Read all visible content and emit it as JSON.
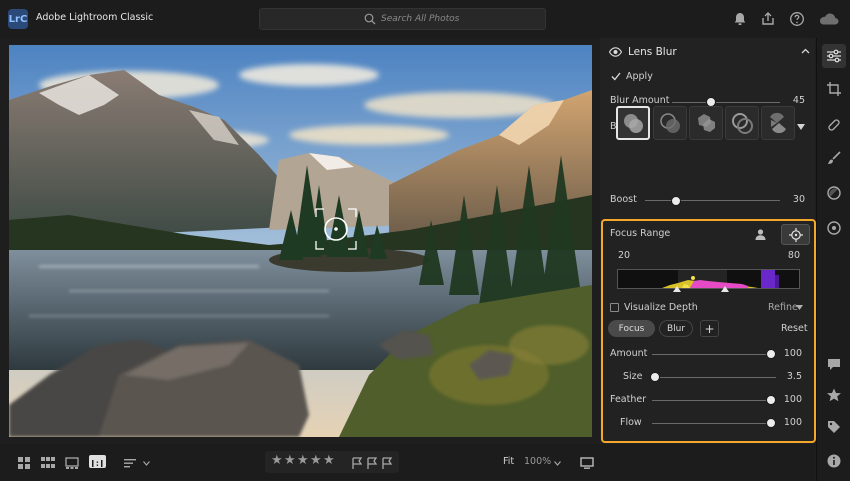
{
  "app": {
    "logo": "LrC",
    "title": "Adobe Lightroom Classic"
  },
  "search": {
    "placeholder": "Search All Photos"
  },
  "panel": {
    "title": "Lens Blur",
    "apply_label": "Apply",
    "apply_checked": true,
    "blur_amount": {
      "label": "Blur Amount",
      "value": 45,
      "max": 100
    },
    "bokeh": {
      "label": "Bokeh",
      "shapes": [
        "circle",
        "bubble",
        "blade",
        "ring",
        "cat-eye"
      ],
      "selected": 0
    },
    "boost": {
      "label": "Boost",
      "value": 30,
      "max": 100
    },
    "focus_range": {
      "label": "Focus Range",
      "low": "20",
      "high": "80"
    },
    "visualize_depth": {
      "label": "Visualize Depth",
      "checked": false
    },
    "refine_label": "Refine",
    "modes": {
      "focus": "Focus",
      "blur": "Blur",
      "add": "+",
      "reset": "Reset"
    },
    "amount": {
      "label": "Amount",
      "value": "100",
      "fraction": 1.0
    },
    "size": {
      "label": "Size",
      "value": "3.5",
      "fraction": 0.0
    },
    "feather": {
      "label": "Feather",
      "value": "100",
      "fraction": 1.0
    },
    "flow": {
      "label": "Flow",
      "value": "100",
      "fraction": 1.0
    }
  },
  "bottombar": {
    "zoom_fit": "Fit",
    "zoom_level": "100%",
    "rating_stars": 5
  },
  "colors": {
    "accent": "#f4a72a",
    "background": "#1e1e1e",
    "panel": "#222222"
  }
}
